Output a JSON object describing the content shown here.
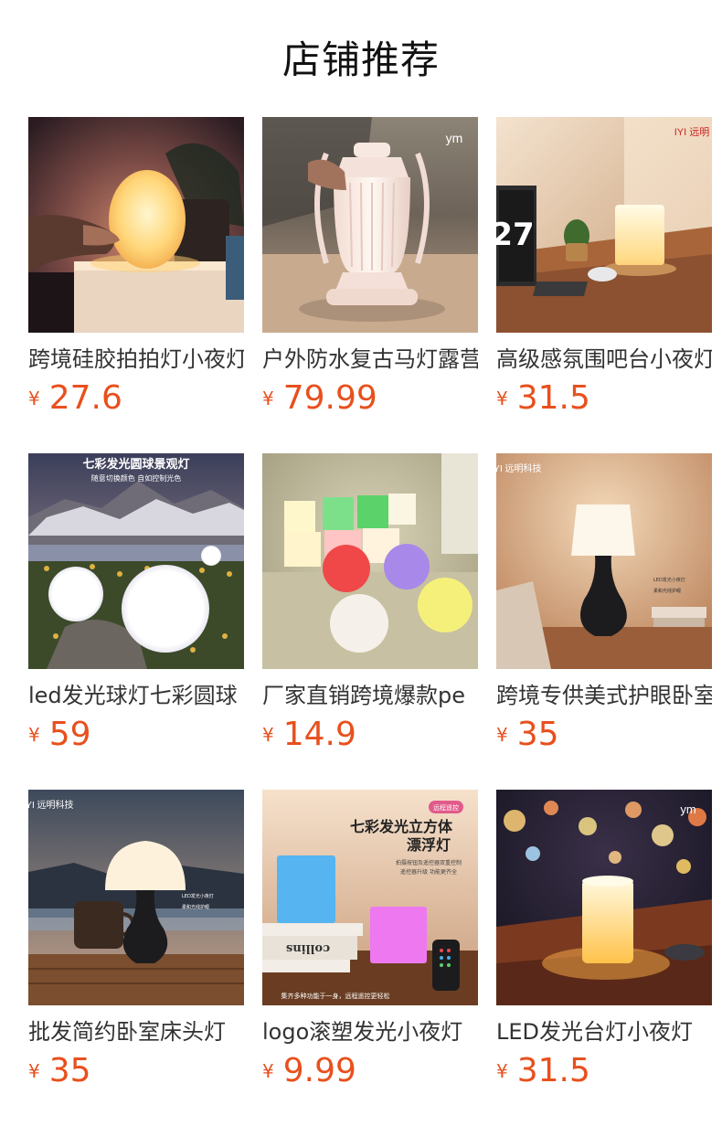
{
  "header": {
    "title": "店铺推荐"
  },
  "currency_symbol": "¥",
  "products": [
    {
      "name": "跨境硅胶拍拍灯小夜灯",
      "price": "27.6"
    },
    {
      "name": "户外防水复古马灯露营",
      "price": "79.99"
    },
    {
      "name": "高级感氛围吧台小夜灯",
      "price": "31.5"
    },
    {
      "name": "led发光球灯七彩圆球",
      "price": "59"
    },
    {
      "name": "厂家直销跨境爆款pe",
      "price": "14.9"
    },
    {
      "name": "跨境专供美式护眼卧室",
      "price": "35"
    },
    {
      "name": "批发简约卧室床头灯",
      "price": "35"
    },
    {
      "name": "logo滚塑发光小夜灯",
      "price": "9.99"
    },
    {
      "name": "LED发光台灯小夜灯",
      "price": "31.5"
    }
  ],
  "image_text": {
    "img2_logo": "ym",
    "img3_logo": "IYI 远明",
    "img3_clock": "27",
    "img4_title": "七彩发光圆球景观灯",
    "img4_sub": "随意切换颜色 自如控制光色",
    "img6_logo": "IYI 远明科技",
    "img6_label1": "LED发光小夜灯",
    "img6_label2": "柔和光线护眼",
    "img7_logo": "IYI 远明科技",
    "img7_label1": "LED发光小夜灯",
    "img7_label2": "柔和光线护眼",
    "img8_badge": "远程遥控",
    "img8_title1": "七彩发光立方体",
    "img8_title2": "漂浮灯",
    "img8_sub1": "拍摄按钮及遥控器双重控制",
    "img8_sub2": "遥控器升级 功能更齐全",
    "img8_book": "collins",
    "img8_bottom": "集齐多种功能于一身，远程遥控更轻松",
    "img9_logo": "ym"
  }
}
